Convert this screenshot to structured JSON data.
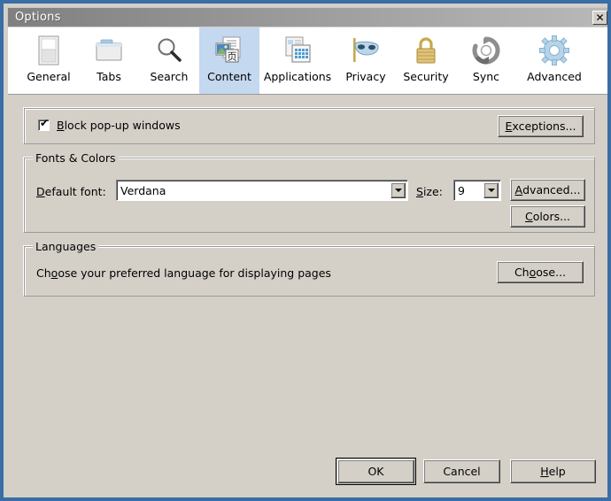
{
  "window": {
    "title": "Options",
    "close_label": "✕",
    "accent_border": "#3a6ea5",
    "body_background": "#d4d0c8",
    "selected_tab_background": "#c4d8ef"
  },
  "tabs": [
    {
      "id": "general",
      "label": "General",
      "icon": "browser-window-icon",
      "selected": false
    },
    {
      "id": "tabs",
      "label": "Tabs",
      "icon": "folder-tab-icon",
      "selected": false
    },
    {
      "id": "search",
      "label": "Search",
      "icon": "magnifier-icon",
      "selected": false
    },
    {
      "id": "content",
      "label": "Content",
      "icon": "content-pages-icon",
      "selected": true
    },
    {
      "id": "applications",
      "label": "Applications",
      "icon": "applications-icon",
      "selected": false
    },
    {
      "id": "privacy",
      "label": "Privacy",
      "icon": "mask-icon",
      "selected": false
    },
    {
      "id": "security",
      "label": "Security",
      "icon": "padlock-icon",
      "selected": false
    },
    {
      "id": "sync",
      "label": "Sync",
      "icon": "sync-arrows-icon",
      "selected": false
    },
    {
      "id": "advanced",
      "label": "Advanced",
      "icon": "gear-icon",
      "selected": false
    }
  ],
  "popup_group": {
    "checkbox": {
      "label_before": "B",
      "label_after": "lock pop-up windows",
      "checked": true,
      "check_glyph": "✔"
    },
    "exceptions_button": {
      "label_before": "E",
      "label_after": "xceptions..."
    }
  },
  "fonts_colors_group": {
    "title": "Fonts & Colors",
    "default_font_label_before": "D",
    "default_font_label_after": "efault font:",
    "default_font_value": "Verdana",
    "size_label_before": "S",
    "size_label_after": "ize:",
    "size_value": "9",
    "advanced_button": {
      "label_before": "A",
      "label_after": "dvanced..."
    },
    "colors_button": {
      "label_before": "C",
      "label_after": "olors..."
    }
  },
  "languages_group": {
    "title": "Languages",
    "description_pre": "Ch",
    "description_acc": "o",
    "description_post": "ose your preferred language for displaying pages",
    "choose_button": {
      "label_pre": "Ch",
      "label_acc": "o",
      "label_post": "ose..."
    }
  },
  "dialog_buttons": {
    "ok": "OK",
    "cancel": "Cancel",
    "help_before": "H",
    "help_after": "elp"
  }
}
